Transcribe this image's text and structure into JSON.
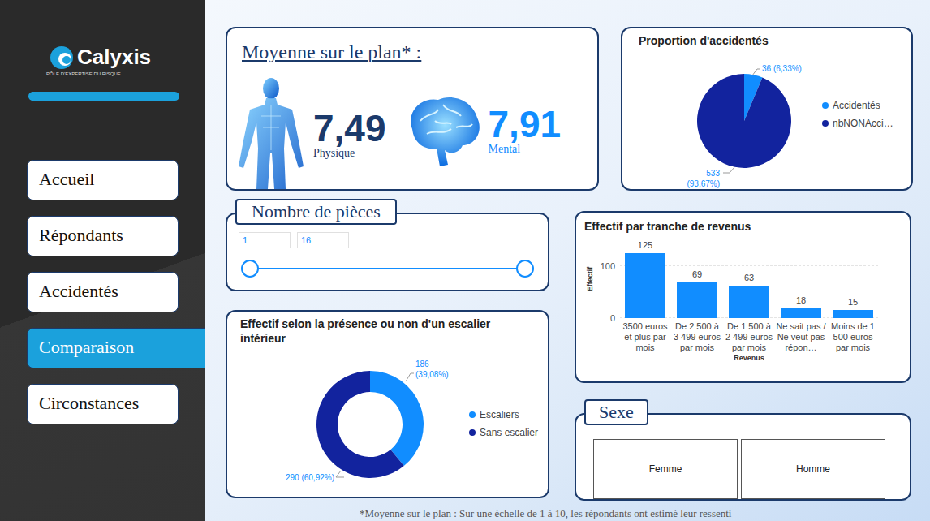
{
  "sidebar": {
    "logo": {
      "name": "Calyxis",
      "tagline": "PÔLE D'EXPERTISE DU RISQUE"
    },
    "items": [
      {
        "label": "Accueil",
        "selected": false
      },
      {
        "label": "Répondants",
        "selected": false
      },
      {
        "label": "Accidentés",
        "selected": false
      },
      {
        "label": "Comparaison",
        "selected": true
      },
      {
        "label": "Circonstances",
        "selected": false
      }
    ]
  },
  "averages": {
    "title": "Moyenne sur le plan* :",
    "metrics": [
      {
        "value": "7,49",
        "label": "Physique",
        "color": "#1b3a6b"
      },
      {
        "value": "7,91",
        "label": "Mental",
        "color": "#118dff"
      }
    ]
  },
  "accident_share": {
    "title": "Proportion d'accidentés",
    "slices": [
      {
        "label": "Accidentés",
        "value": 36,
        "count": "36",
        "share": "(6,33%)",
        "color": "#118dff"
      },
      {
        "label": "nbNONAcci…",
        "value": 533,
        "count": "533",
        "share": "(93,67%)",
        "color": "#12239e"
      }
    ]
  },
  "rooms_slider": {
    "title": "Nombre de pièces",
    "min": "1",
    "max": "16",
    "level_low": 0,
    "level_high": 1
  },
  "stairs": {
    "title": "Effectif selon la présence ou non d'un escalier intérieur",
    "slices": [
      {
        "label": "Escaliers",
        "value": 186,
        "count": "186",
        "share": "(39,08%)",
        "color": "#118dff"
      },
      {
        "label": "Sans escalier",
        "value": 290,
        "count": "290",
        "share": "(60,92%)",
        "color": "#12239e"
      }
    ]
  },
  "income": {
    "title": "Effectif par tranche de revenus",
    "y_axis": "Effectif",
    "x_axis": "Revenus",
    "ticks": [
      "100",
      "0"
    ],
    "values": [
      125,
      69,
      63,
      18,
      15
    ],
    "value_labels": [
      "125",
      "69",
      "63",
      "18",
      "15"
    ],
    "categories": [
      "3500 euros et plus par mois",
      "De 2 500 à 3 499 euros par mois",
      "De 1 500 à 2 499 euros par mois",
      "Ne sait pas / Ne veut pas répon…",
      "Moins de 1 500 euros par mois"
    ]
  },
  "sex": {
    "title": "Sexe",
    "options": [
      {
        "label": "Femme",
        "selected": false
      },
      {
        "label": "Homme",
        "selected": false
      }
    ]
  },
  "footnote": "*Moyenne sur le plan : Sur une échelle de 1 à 10, les répondants ont estimé leur ressenti"
}
